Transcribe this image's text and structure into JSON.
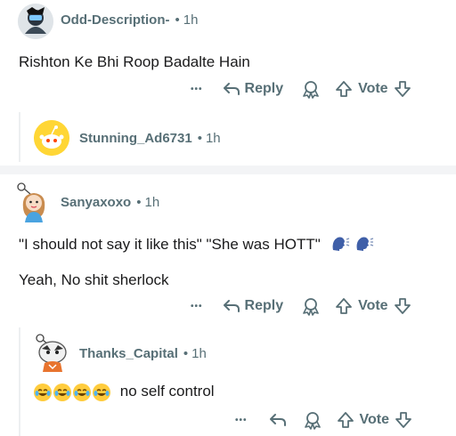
{
  "comments": [
    {
      "username": "Odd-Description-",
      "age": "1h",
      "body": "Rishton Ke Bhi Roop Badalte Hain",
      "more_label": "•••",
      "reply_label": "Reply",
      "vote_label": "Vote"
    },
    {
      "username": "Stunning_Ad6731",
      "age": "1h"
    },
    {
      "username": "Sanyaxoxo",
      "age": "1h",
      "body_line1": "\"I should not say it like this\" \"She was HOTT\"",
      "body_line2": "Yeah, No shit sherlock",
      "more_label": "•••",
      "reply_label": "Reply",
      "vote_label": "Vote"
    },
    {
      "username": "Thanks_Capital",
      "age": "1h",
      "body": "no self control",
      "more_label": "•••",
      "vote_label": "Vote"
    }
  ],
  "separator": "•",
  "colors": {
    "meta": "#576f76",
    "text": "#1a1a1b",
    "thread_line": "#edeff1",
    "divider": "#f3f4f6"
  },
  "icons": [
    "snoo-avatar-icon",
    "reply-arrow-icon",
    "award-icon",
    "upvote-icon",
    "downvote-icon",
    "speaking-head-icon",
    "crying-laughing-emoji-icon"
  ]
}
